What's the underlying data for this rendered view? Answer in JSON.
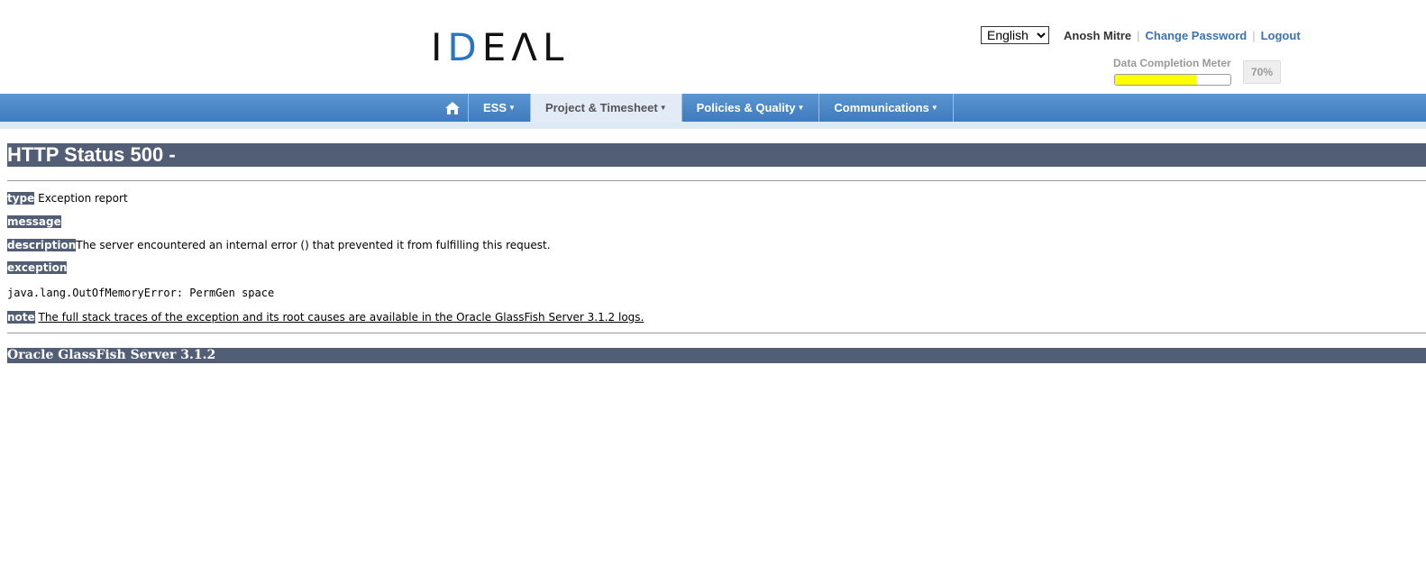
{
  "header": {
    "logo_prefix": "I",
    "logo_accent": "D",
    "logo_suffix": "EΛL",
    "language_selected": "English",
    "user_name": "Anosh Mitre",
    "change_password": "Change Password",
    "logout": "Logout",
    "meter_label": "Data Completion Meter",
    "meter_percent_text": "70%",
    "meter_value": 0.7
  },
  "nav": {
    "items": [
      {
        "label": "ESS"
      },
      {
        "label": "Project & Timesheet"
      },
      {
        "label": "Policies & Quality"
      },
      {
        "label": "Communications"
      }
    ]
  },
  "error": {
    "title": "HTTP Status 500 -",
    "type_label": "type",
    "type_value": "Exception report",
    "message_label": "message",
    "description_label": "description",
    "description_value": "The server encountered an internal error () that prevented it from fulfilling this request.",
    "exception_label": "exception",
    "exception_value": "java.lang.OutOfMemoryError: PermGen space",
    "note_label": "note",
    "note_value": "The full stack traces of the exception and its root causes are available in the Oracle GlassFish Server 3.1.2 logs.",
    "footer": "Oracle GlassFish Server 3.1.2"
  },
  "colors": {
    "accent": "#2a74c4",
    "nav": "#4a87c7",
    "error_header": "#525d76",
    "meter_fill": "#ffff00"
  }
}
